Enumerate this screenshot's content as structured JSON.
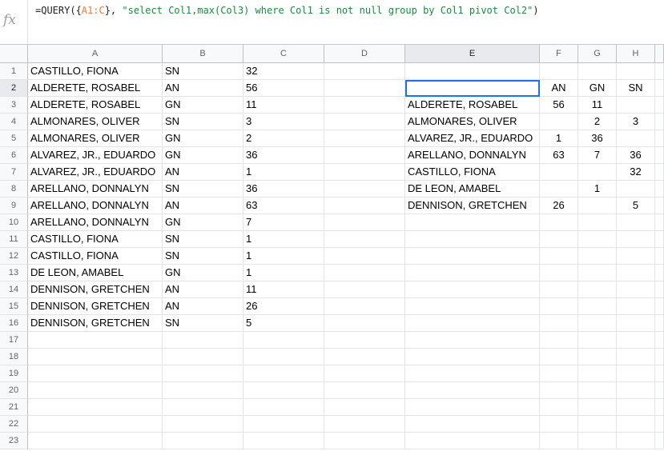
{
  "formula_bar": {
    "fx_label": "fx",
    "formula_prefix": "=QUERY({",
    "formula_range": "A1:C",
    "formula_mid": "}, ",
    "formula_string": "\"select Col1,max(Col3) where Col1 is not null group by Col1 pivot Col2\"",
    "formula_suffix": ")"
  },
  "columns": [
    "A",
    "B",
    "C",
    "D",
    "E",
    "F",
    "G",
    "H"
  ],
  "rows": [
    "1",
    "2",
    "3",
    "4",
    "5",
    "6",
    "7",
    "8",
    "9",
    "10",
    "11",
    "12",
    "13",
    "14",
    "15",
    "16",
    "17",
    "18",
    "19",
    "20",
    "21",
    "22",
    "23"
  ],
  "source_data": [
    {
      "name": "CASTILLO, FIONA",
      "code": "SN",
      "value": "32"
    },
    {
      "name": "ALDERETE, ROSABEL",
      "code": "AN",
      "value": "56"
    },
    {
      "name": "ALDERETE, ROSABEL",
      "code": "GN",
      "value": "11"
    },
    {
      "name": "ALMONARES, OLIVER",
      "code": "SN",
      "value": "3"
    },
    {
      "name": "ALMONARES, OLIVER",
      "code": "GN",
      "value": "2"
    },
    {
      "name": "ALVAREZ, JR., EDUARDO",
      "code": "GN",
      "value": "36"
    },
    {
      "name": "ALVAREZ, JR., EDUARDO",
      "code": "AN",
      "value": "1"
    },
    {
      "name": "ARELLANO, DONNALYN",
      "code": "SN",
      "value": "36"
    },
    {
      "name": "ARELLANO, DONNALYN",
      "code": "AN",
      "value": "63"
    },
    {
      "name": "ARELLANO, DONNALYN",
      "code": "GN",
      "value": "7"
    },
    {
      "name": "CASTILLO, FIONA",
      "code": "SN",
      "value": "1"
    },
    {
      "name": "CASTILLO, FIONA",
      "code": "SN",
      "value": "1"
    },
    {
      "name": "DE LEON, AMABEL",
      "code": "GN",
      "value": "1"
    },
    {
      "name": "DENNISON, GRETCHEN",
      "code": "AN",
      "value": "11"
    },
    {
      "name": "DENNISON, GRETCHEN",
      "code": "AN",
      "value": "26"
    },
    {
      "name": "DENNISON, GRETCHEN",
      "code": "SN",
      "value": "5"
    }
  ],
  "pivot": {
    "header": [
      "",
      "AN",
      "GN",
      "SN"
    ],
    "rows": [
      [
        "ALDERETE, ROSABEL",
        "56",
        "11",
        ""
      ],
      [
        "ALMONARES, OLIVER",
        "",
        "2",
        "3"
      ],
      [
        "ALVAREZ, JR., EDUARDO",
        "1",
        "36",
        ""
      ],
      [
        "ARELLANO, DONNALYN",
        "63",
        "7",
        "36"
      ],
      [
        "CASTILLO, FIONA",
        "",
        "",
        "32"
      ],
      [
        "DE LEON, AMABEL",
        "",
        "1",
        ""
      ],
      [
        "DENNISON, GRETCHEN",
        "26",
        "",
        "5"
      ]
    ]
  },
  "selection": {
    "column": "E",
    "row": "2"
  }
}
